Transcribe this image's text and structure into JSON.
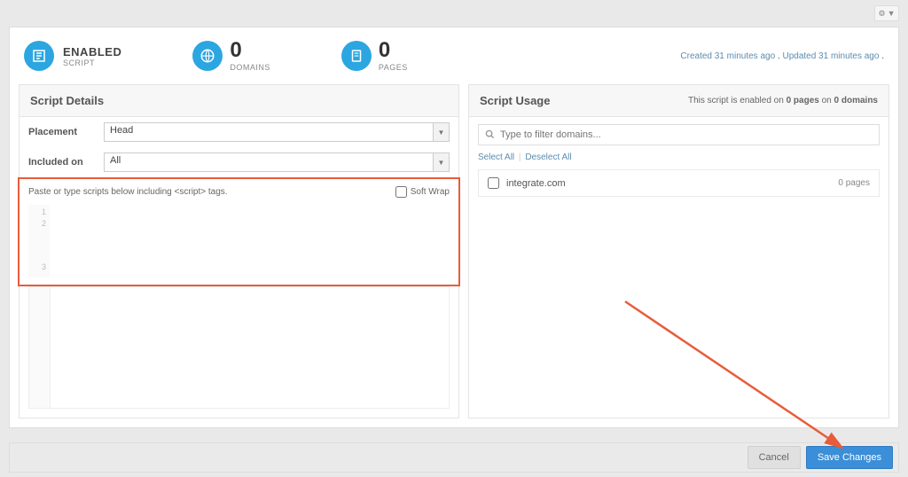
{
  "header": {
    "status_title": "ENABLED",
    "status_sub": "SCRIPT",
    "domains_count": "0",
    "domains_label": "DOMAINS",
    "pages_count": "0",
    "pages_label": "PAGES",
    "created_text": "Created 31 minutes ago",
    "updated_text": "Updated 31 minutes ago",
    "dot": " . "
  },
  "details": {
    "title": "Script Details",
    "placement_label": "Placement",
    "placement_value": "Head",
    "included_label": "Included on",
    "included_value": "All",
    "instructions": "Paste or type scripts below including <script> tags.",
    "soft_wrap_label": "Soft Wrap",
    "gutter1": "1",
    "gutter2": "2",
    "gutter3": "3"
  },
  "usage": {
    "title": "Script Usage",
    "summary_prefix": "This script is enabled on ",
    "summary_pages": "0 pages",
    "summary_on": " on ",
    "summary_domains": "0 domains",
    "filter_placeholder": "Type to filter domains...",
    "select_all": "Select All",
    "deselect_all": "Deselect All",
    "domain_name": "integrate.com",
    "domain_pages": "0 pages"
  },
  "footer": {
    "cancel": "Cancel",
    "save": "Save Changes"
  }
}
